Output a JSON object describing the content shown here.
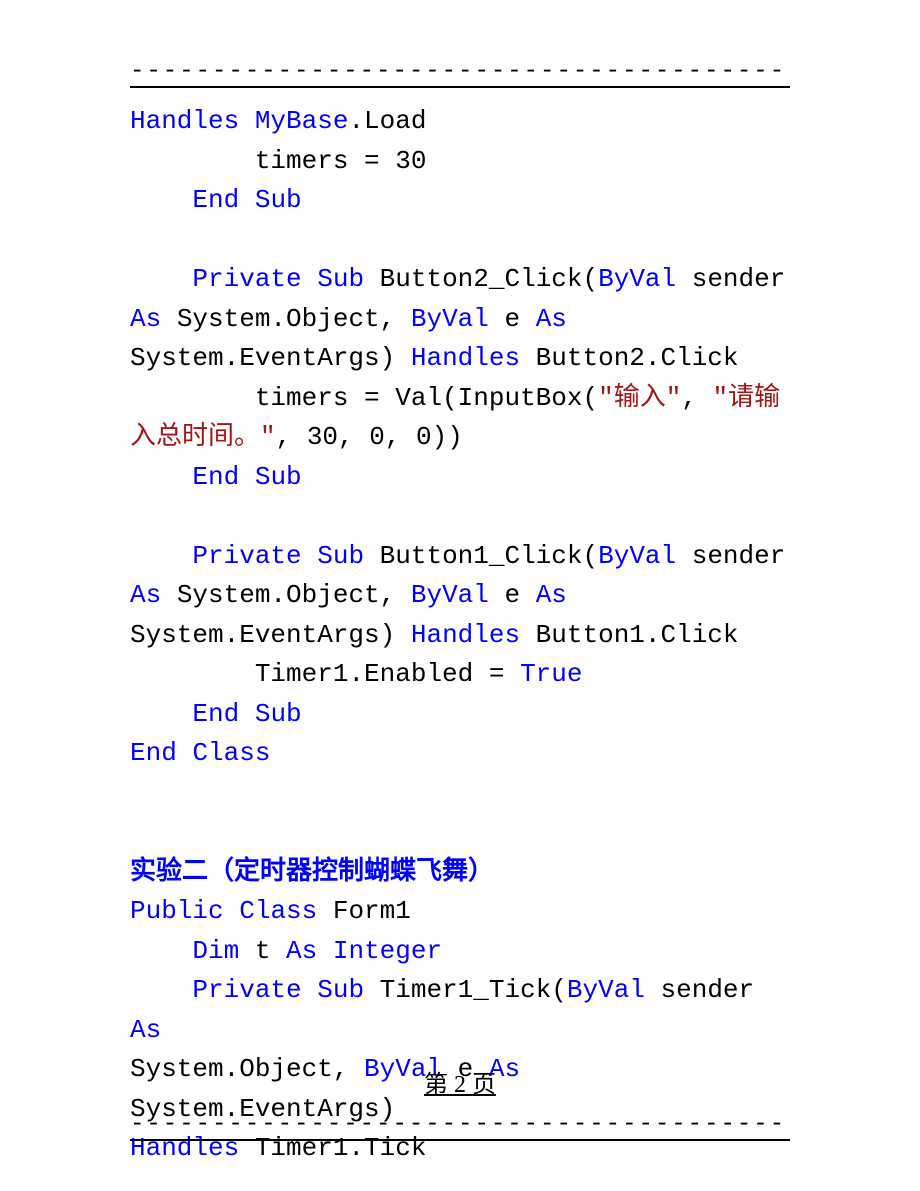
{
  "top": {
    "dashes": "-------------------------------------------"
  },
  "code1": {
    "l1a": "Handles",
    "l1b": " ",
    "l1c": "MyBase",
    "l1d": ".Load",
    "l2a": "        timers = 30",
    "l3a": "    ",
    "l3b": "End",
    "l3c": " ",
    "l3d": "Sub",
    "l4": "",
    "l5a": "    ",
    "l5b": "Private",
    "l5c": " ",
    "l5d": "Sub",
    "l5e": " Button2_Click(",
    "l5f": "ByVal",
    "l5g": " sender ",
    "l6a": "As",
    "l6b": " System.Object, ",
    "l6c": "ByVal",
    "l6d": " e ",
    "l6e": "As",
    "l6f": " ",
    "l7a": "System.EventArgs) ",
    "l7b": "Handles",
    "l7c": " Button2.Click",
    "l8a": "        timers = Val(InputBox(",
    "l8b": "\"输入\"",
    "l8c": ", ",
    "l8d": "\"请输",
    "l9a": "入总时间。\"",
    "l9b": ", 30, 0, 0))",
    "l10a": "    ",
    "l10b": "End",
    "l10c": " ",
    "l10d": "Sub",
    "l11": "",
    "l12a": "    ",
    "l12b": "Private",
    "l12c": " ",
    "l12d": "Sub",
    "l12e": " Button1_Click(",
    "l12f": "ByVal",
    "l12g": " sender ",
    "l13a": "As",
    "l13b": " System.Object, ",
    "l13c": "ByVal",
    "l13d": " e ",
    "l13e": "As",
    "l13f": " ",
    "l14a": "System.EventArgs) ",
    "l14b": "Handles",
    "l14c": " Button1.Click",
    "l15a": "        Timer1.Enabled = ",
    "l15b": "True",
    "l16a": "    ",
    "l16b": "End",
    "l16c": " ",
    "l16d": "Sub",
    "l17a": "End",
    "l17b": " ",
    "l17c": "Class"
  },
  "section2": {
    "title": "实验二（定时器控制蝴蝶飞舞）",
    "l1a": "Public",
    "l1b": " ",
    "l1c": "Class",
    "l1d": " Form1",
    "l2a": "    ",
    "l2b": "Dim",
    "l2c": " t ",
    "l2d": "As",
    "l2e": " ",
    "l2f": "Integer",
    "l3a": "    ",
    "l3b": "Private",
    "l3c": " ",
    "l3d": "Sub",
    "l3e": " Timer1_Tick(",
    "l3f": "ByVal",
    "l3g": " sender ",
    "l3h": "As",
    "l3i": " ",
    "l4a": "System.Object, ",
    "l4b": "ByVal",
    "l4c": " e ",
    "l4d": "As",
    "l4e": " System.EventArgs) ",
    "l5a": "Handles",
    "l5b": " Timer1.Tick"
  },
  "footer": {
    "page": "第 2 页",
    "dashes": "-------------------------------------------"
  }
}
